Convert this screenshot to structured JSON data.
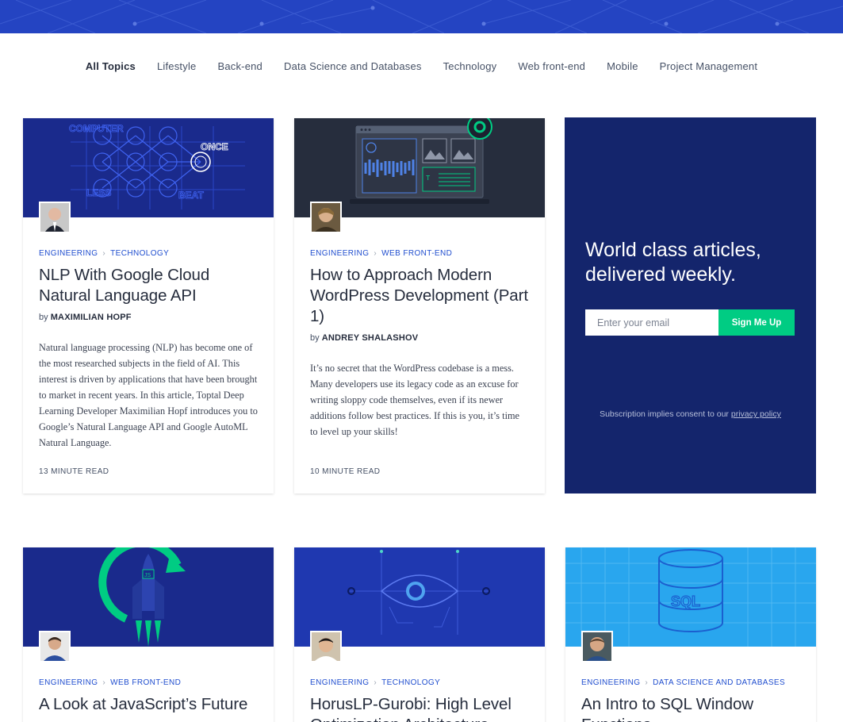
{
  "nav": {
    "topics": [
      "All Topics",
      "Lifestyle",
      "Back-end",
      "Data Science and Databases",
      "Technology",
      "Web front-end",
      "Mobile",
      "Project Management"
    ],
    "active": "All Topics"
  },
  "cards": [
    {
      "tags": [
        "ENGINEERING",
        "TECHNOLOGY"
      ],
      "title": "NLP With Google Cloud Natural Language API",
      "by": "by",
      "author": "MAXIMILIAN HOPF",
      "excerpt": "Natural language processing (NLP) has become one of the most researched subjects in the field of AI. This interest is driven by applications that have been brought to market in recent years. In this article, Toptal Deep Learning Developer Maximilian Hopf introduces you to Google’s Natural Language API and Google AutoML Natural Language.",
      "read_time": "13 MINUTE READ",
      "hero_words": [
        "COMPUTER",
        "ONCE",
        "LESS",
        "BEAT"
      ]
    },
    {
      "tags": [
        "ENGINEERING",
        "WEB FRONT-END"
      ],
      "title": "How to Approach Modern WordPress Development (Part 1)",
      "by": "by",
      "author": "ANDREY SHALASHOV",
      "excerpt": "It’s no secret that the WordPress codebase is a mess. Many developers use its legacy code as an excuse for writing sloppy code themselves, even if its newer additions follow best practices. If this is you, it’s time to level up your skills!",
      "read_time": "10 MINUTE READ"
    },
    {
      "tags": [
        "ENGINEERING",
        "WEB FRONT-END"
      ],
      "title": "A Look at JavaScript’s Future",
      "hero_badge": "JS"
    },
    {
      "tags": [
        "ENGINEERING",
        "TECHNOLOGY"
      ],
      "title": "HorusLP-Gurobi: High Level Optimization Architecture"
    },
    {
      "tags": [
        "ENGINEERING",
        "DATA SCIENCE AND DATABASES"
      ],
      "title": "An Intro to SQL Window Functions",
      "hero_label": "SQL"
    }
  ],
  "subscribe": {
    "heading": "World class articles, delivered weekly.",
    "email_placeholder": "Enter your email",
    "button": "Sign Me Up",
    "consent_text": "Subscription implies consent to our",
    "consent_link": "privacy policy"
  },
  "colors": {
    "brand_blue": "#204ecf",
    "navy": "#14256c",
    "cta_green": "#00cc83"
  }
}
